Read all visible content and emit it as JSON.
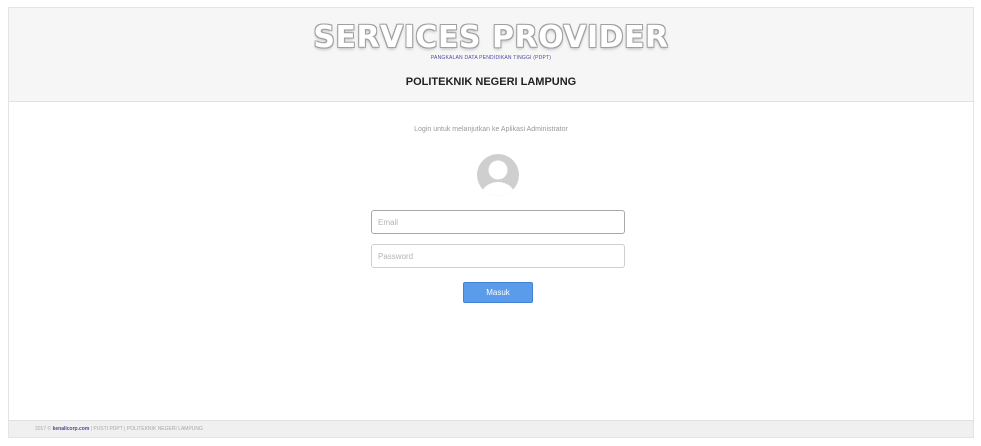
{
  "header": {
    "brand_title": "SERVICES PROVIDER",
    "brand_subtitle": "PANGKALAN DATA PENDIDIKAN TINGGI (PDPT)",
    "institution": "POLITEKNIK NEGERI LAMPUNG"
  },
  "login": {
    "intro_text": "Login untuk melanjutkan ke Aplikasi Administrator",
    "avatar_icon": "user-avatar-icon",
    "email_placeholder": "Email",
    "password_placeholder": "Password",
    "submit_label": "Masuk",
    "accent_color": "#5a9bea"
  },
  "footer": {
    "year": "2017 ©",
    "company_link": "kenalicorp.com",
    "trail": "| PUSTI PDPT | POLITEKNIK NEGERI LAMPUNG"
  }
}
